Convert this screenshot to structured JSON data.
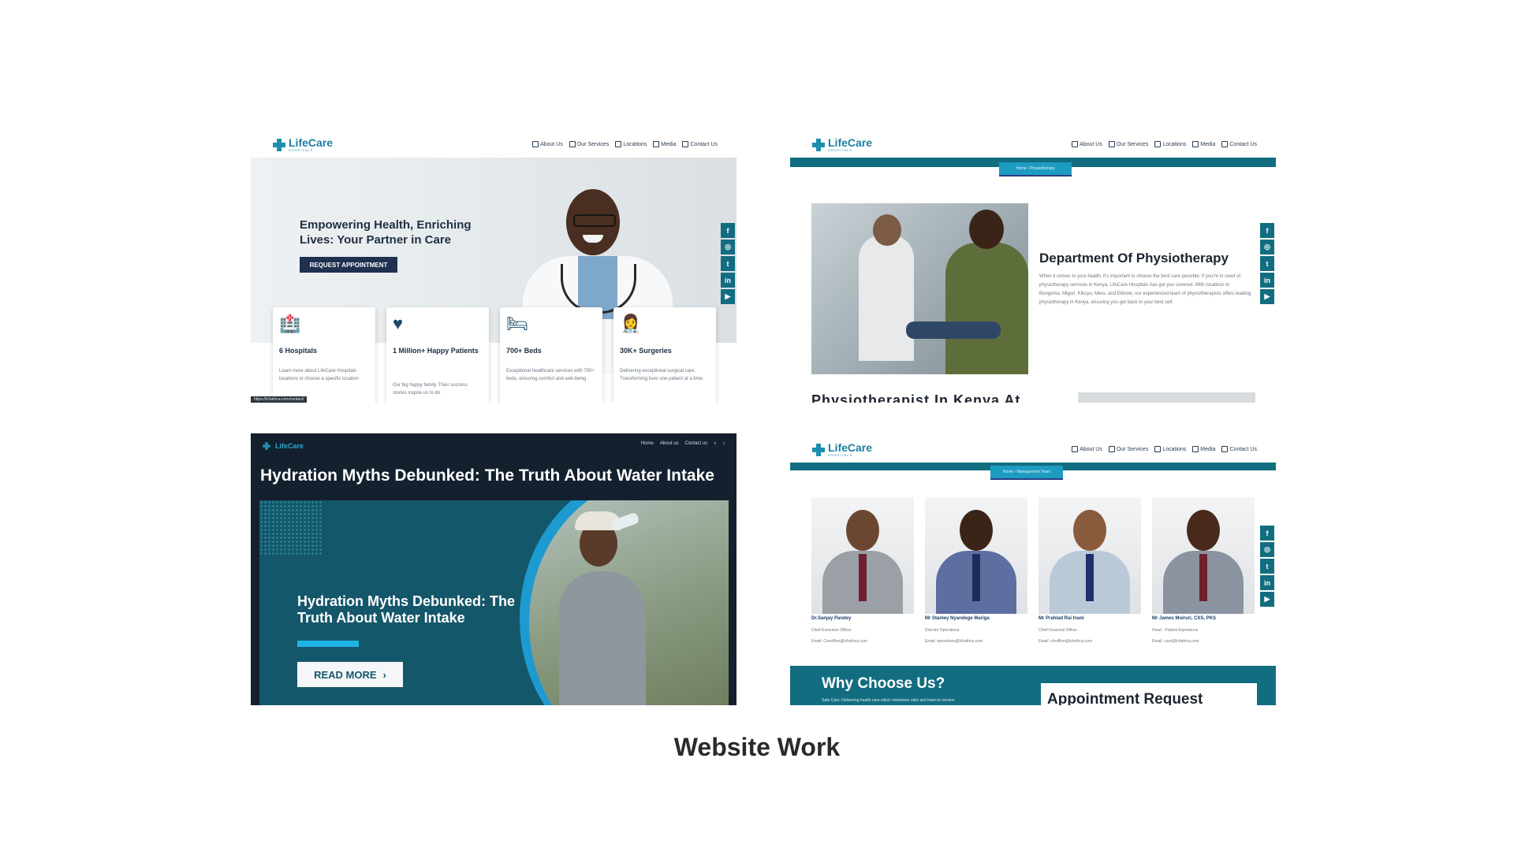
{
  "caption": "Website Work",
  "brand": {
    "name": "LifeCare",
    "sub": "HOSPITALS",
    "color": "#1a7fa0",
    "teal": "#136d80"
  },
  "nav": [
    "About Us",
    "Our Services",
    "Locations",
    "Media",
    "Contact Us"
  ],
  "social": [
    "f",
    "◎",
    "t",
    "in",
    "▶"
  ],
  "home": {
    "hero_title": "Empowering Health, Enriching Lives: Your Partner in Care",
    "hero_button": "REQUEST APPOINTMENT",
    "stats": [
      {
        "icon": "hospital-icon",
        "glyph": "🏥",
        "title": "6 Hospitals",
        "text": "Learn more about LifeCare Hospitals locations or choose a specific location"
      },
      {
        "icon": "heart-pulse-icon",
        "glyph": "♥",
        "title": "1 Million+ Happy Patients",
        "text": "Our big happy family. Their success stories inspire us to do"
      },
      {
        "icon": "bed-icon",
        "glyph": "🛏",
        "title": "700+ Beds",
        "text": "Exceptional healthcare services with 700+ beds, ensuring comfort and well-being."
      },
      {
        "icon": "doctor-icon",
        "glyph": "👩‍⚕️",
        "title": "30K+ Surgeries",
        "text": "Delivering exceptional surgical care. Transforming lives one patient at a time."
      }
    ],
    "status_url": "https://lchafrica.com/contact/"
  },
  "physio": {
    "breadcrumb": "Home › Physiotherapy",
    "title": "Department Of Physiotherapy",
    "text": "When it comes to your health, it's important to choose the best care possible. If you're in need of physiotherapy services in Kenya, LifeCare Hospitals has got you covered. With locations in Bungoma, Migori, Kikuyu, Meru, and Eldoret, our experienced team of physiotherapists offers leading physiotherapy in Kenya, ensuring you get back to your best self.",
    "cut_heading": "Physiotherapist In Kenya At"
  },
  "blog": {
    "logo": "LifeCare",
    "menu": [
      "Home",
      "About us",
      "Contact us"
    ],
    "title": "Hydration Myths Debunked: The Truth About Water Intake",
    "card_title": "Hydration Myths Debunked: The Truth About Water Intake",
    "button": "READ MORE"
  },
  "team": {
    "breadcrumb": "Home › Management Team",
    "members": [
      {
        "name": "Dr.Sanjay Pandey",
        "role": "Chief Executive Officer",
        "email": "Email: Ceooffice@lchafrica.com",
        "suit": "#9aa0a6",
        "tie": "#6e2030"
      },
      {
        "name": "Mr Stanley Nyandege Mariga",
        "role": "Director Operations",
        "email": "Email: operations@lchafrica.com",
        "suit": "#5d6fa0",
        "tie": "#1d2c58"
      },
      {
        "name": "Mr Prahlad Rai Inani",
        "role": "Chief Financial Officer",
        "email": "Email: cfooffice@lchafrica.com",
        "suit": "#b9c9d8",
        "tie": "#20306a"
      },
      {
        "name": "Mr James Muiruri, CXS, PKS",
        "role": "Head - Patient Experience",
        "email": "Email: care@lchafrica.com",
        "suit": "#8c93a0",
        "tie": "#6e2030"
      }
    ],
    "why_title": "Why Choose Us?",
    "why_text": "Safe Care: Delivering health care which minimizes risks and harm to service",
    "appt_title": "Appointment Request"
  }
}
